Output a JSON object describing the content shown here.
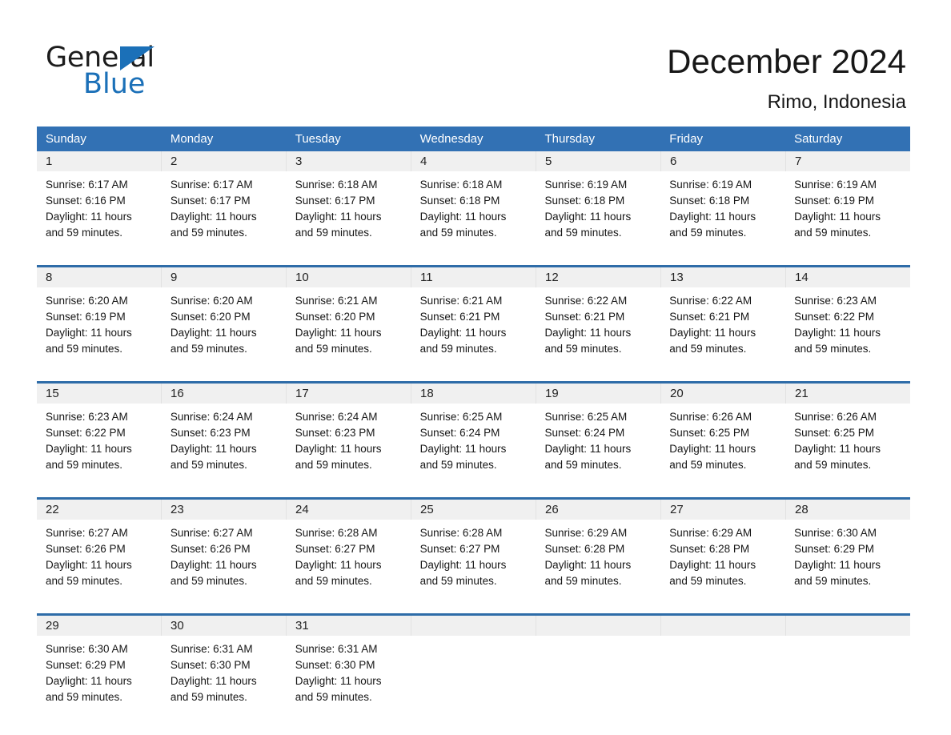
{
  "brand": {
    "name_part1": "General",
    "name_part2": "Blue",
    "accent_color": "#1b70b8"
  },
  "header": {
    "title": "December 2024",
    "location": "Rimo, Indonesia"
  },
  "theme": {
    "header_blue": "#3271b4",
    "row_rule_blue": "#2e6ca8",
    "date_band_gray": "#f0f0f0"
  },
  "weekdays": [
    "Sunday",
    "Monday",
    "Tuesday",
    "Wednesday",
    "Thursday",
    "Friday",
    "Saturday"
  ],
  "labels": {
    "sunrise_prefix": "Sunrise:",
    "sunset_prefix": "Sunset:",
    "daylight_prefix": "Daylight:"
  },
  "weeks": [
    {
      "dates": [
        "1",
        "2",
        "3",
        "4",
        "5",
        "6",
        "7"
      ],
      "days": [
        {
          "date": "1",
          "sunrise": "Sunrise: 6:17 AM",
          "sunset": "Sunset: 6:16 PM",
          "daylight_line1": "Daylight: 11 hours",
          "daylight_line2": "and 59 minutes."
        },
        {
          "date": "2",
          "sunrise": "Sunrise: 6:17 AM",
          "sunset": "Sunset: 6:17 PM",
          "daylight_line1": "Daylight: 11 hours",
          "daylight_line2": "and 59 minutes."
        },
        {
          "date": "3",
          "sunrise": "Sunrise: 6:18 AM",
          "sunset": "Sunset: 6:17 PM",
          "daylight_line1": "Daylight: 11 hours",
          "daylight_line2": "and 59 minutes."
        },
        {
          "date": "4",
          "sunrise": "Sunrise: 6:18 AM",
          "sunset": "Sunset: 6:18 PM",
          "daylight_line1": "Daylight: 11 hours",
          "daylight_line2": "and 59 minutes."
        },
        {
          "date": "5",
          "sunrise": "Sunrise: 6:19 AM",
          "sunset": "Sunset: 6:18 PM",
          "daylight_line1": "Daylight: 11 hours",
          "daylight_line2": "and 59 minutes."
        },
        {
          "date": "6",
          "sunrise": "Sunrise: 6:19 AM",
          "sunset": "Sunset: 6:18 PM",
          "daylight_line1": "Daylight: 11 hours",
          "daylight_line2": "and 59 minutes."
        },
        {
          "date": "7",
          "sunrise": "Sunrise: 6:19 AM",
          "sunset": "Sunset: 6:19 PM",
          "daylight_line1": "Daylight: 11 hours",
          "daylight_line2": "and 59 minutes."
        }
      ]
    },
    {
      "dates": [
        "8",
        "9",
        "10",
        "11",
        "12",
        "13",
        "14"
      ],
      "days": [
        {
          "date": "8",
          "sunrise": "Sunrise: 6:20 AM",
          "sunset": "Sunset: 6:19 PM",
          "daylight_line1": "Daylight: 11 hours",
          "daylight_line2": "and 59 minutes."
        },
        {
          "date": "9",
          "sunrise": "Sunrise: 6:20 AM",
          "sunset": "Sunset: 6:20 PM",
          "daylight_line1": "Daylight: 11 hours",
          "daylight_line2": "and 59 minutes."
        },
        {
          "date": "10",
          "sunrise": "Sunrise: 6:21 AM",
          "sunset": "Sunset: 6:20 PM",
          "daylight_line1": "Daylight: 11 hours",
          "daylight_line2": "and 59 minutes."
        },
        {
          "date": "11",
          "sunrise": "Sunrise: 6:21 AM",
          "sunset": "Sunset: 6:21 PM",
          "daylight_line1": "Daylight: 11 hours",
          "daylight_line2": "and 59 minutes."
        },
        {
          "date": "12",
          "sunrise": "Sunrise: 6:22 AM",
          "sunset": "Sunset: 6:21 PM",
          "daylight_line1": "Daylight: 11 hours",
          "daylight_line2": "and 59 minutes."
        },
        {
          "date": "13",
          "sunrise": "Sunrise: 6:22 AM",
          "sunset": "Sunset: 6:21 PM",
          "daylight_line1": "Daylight: 11 hours",
          "daylight_line2": "and 59 minutes."
        },
        {
          "date": "14",
          "sunrise": "Sunrise: 6:23 AM",
          "sunset": "Sunset: 6:22 PM",
          "daylight_line1": "Daylight: 11 hours",
          "daylight_line2": "and 59 minutes."
        }
      ]
    },
    {
      "dates": [
        "15",
        "16",
        "17",
        "18",
        "19",
        "20",
        "21"
      ],
      "days": [
        {
          "date": "15",
          "sunrise": "Sunrise: 6:23 AM",
          "sunset": "Sunset: 6:22 PM",
          "daylight_line1": "Daylight: 11 hours",
          "daylight_line2": "and 59 minutes."
        },
        {
          "date": "16",
          "sunrise": "Sunrise: 6:24 AM",
          "sunset": "Sunset: 6:23 PM",
          "daylight_line1": "Daylight: 11 hours",
          "daylight_line2": "and 59 minutes."
        },
        {
          "date": "17",
          "sunrise": "Sunrise: 6:24 AM",
          "sunset": "Sunset: 6:23 PM",
          "daylight_line1": "Daylight: 11 hours",
          "daylight_line2": "and 59 minutes."
        },
        {
          "date": "18",
          "sunrise": "Sunrise: 6:25 AM",
          "sunset": "Sunset: 6:24 PM",
          "daylight_line1": "Daylight: 11 hours",
          "daylight_line2": "and 59 minutes."
        },
        {
          "date": "19",
          "sunrise": "Sunrise: 6:25 AM",
          "sunset": "Sunset: 6:24 PM",
          "daylight_line1": "Daylight: 11 hours",
          "daylight_line2": "and 59 minutes."
        },
        {
          "date": "20",
          "sunrise": "Sunrise: 6:26 AM",
          "sunset": "Sunset: 6:25 PM",
          "daylight_line1": "Daylight: 11 hours",
          "daylight_line2": "and 59 minutes."
        },
        {
          "date": "21",
          "sunrise": "Sunrise: 6:26 AM",
          "sunset": "Sunset: 6:25 PM",
          "daylight_line1": "Daylight: 11 hours",
          "daylight_line2": "and 59 minutes."
        }
      ]
    },
    {
      "dates": [
        "22",
        "23",
        "24",
        "25",
        "26",
        "27",
        "28"
      ],
      "days": [
        {
          "date": "22",
          "sunrise": "Sunrise: 6:27 AM",
          "sunset": "Sunset: 6:26 PM",
          "daylight_line1": "Daylight: 11 hours",
          "daylight_line2": "and 59 minutes."
        },
        {
          "date": "23",
          "sunrise": "Sunrise: 6:27 AM",
          "sunset": "Sunset: 6:26 PM",
          "daylight_line1": "Daylight: 11 hours",
          "daylight_line2": "and 59 minutes."
        },
        {
          "date": "24",
          "sunrise": "Sunrise: 6:28 AM",
          "sunset": "Sunset: 6:27 PM",
          "daylight_line1": "Daylight: 11 hours",
          "daylight_line2": "and 59 minutes."
        },
        {
          "date": "25",
          "sunrise": "Sunrise: 6:28 AM",
          "sunset": "Sunset: 6:27 PM",
          "daylight_line1": "Daylight: 11 hours",
          "daylight_line2": "and 59 minutes."
        },
        {
          "date": "26",
          "sunrise": "Sunrise: 6:29 AM",
          "sunset": "Sunset: 6:28 PM",
          "daylight_line1": "Daylight: 11 hours",
          "daylight_line2": "and 59 minutes."
        },
        {
          "date": "27",
          "sunrise": "Sunrise: 6:29 AM",
          "sunset": "Sunset: 6:28 PM",
          "daylight_line1": "Daylight: 11 hours",
          "daylight_line2": "and 59 minutes."
        },
        {
          "date": "28",
          "sunrise": "Sunrise: 6:30 AM",
          "sunset": "Sunset: 6:29 PM",
          "daylight_line1": "Daylight: 11 hours",
          "daylight_line2": "and 59 minutes."
        }
      ]
    },
    {
      "dates": [
        "29",
        "30",
        "31",
        "",
        "",
        "",
        ""
      ],
      "days": [
        {
          "date": "29",
          "sunrise": "Sunrise: 6:30 AM",
          "sunset": "Sunset: 6:29 PM",
          "daylight_line1": "Daylight: 11 hours",
          "daylight_line2": "and 59 minutes."
        },
        {
          "date": "30",
          "sunrise": "Sunrise: 6:31 AM",
          "sunset": "Sunset: 6:30 PM",
          "daylight_line1": "Daylight: 11 hours",
          "daylight_line2": "and 59 minutes."
        },
        {
          "date": "31",
          "sunrise": "Sunrise: 6:31 AM",
          "sunset": "Sunset: 6:30 PM",
          "daylight_line1": "Daylight: 11 hours",
          "daylight_line2": "and 59 minutes."
        },
        {
          "date": "",
          "sunrise": "",
          "sunset": "",
          "daylight_line1": "",
          "daylight_line2": ""
        },
        {
          "date": "",
          "sunrise": "",
          "sunset": "",
          "daylight_line1": "",
          "daylight_line2": ""
        },
        {
          "date": "",
          "sunrise": "",
          "sunset": "",
          "daylight_line1": "",
          "daylight_line2": ""
        },
        {
          "date": "",
          "sunrise": "",
          "sunset": "",
          "daylight_line1": "",
          "daylight_line2": ""
        }
      ]
    }
  ]
}
